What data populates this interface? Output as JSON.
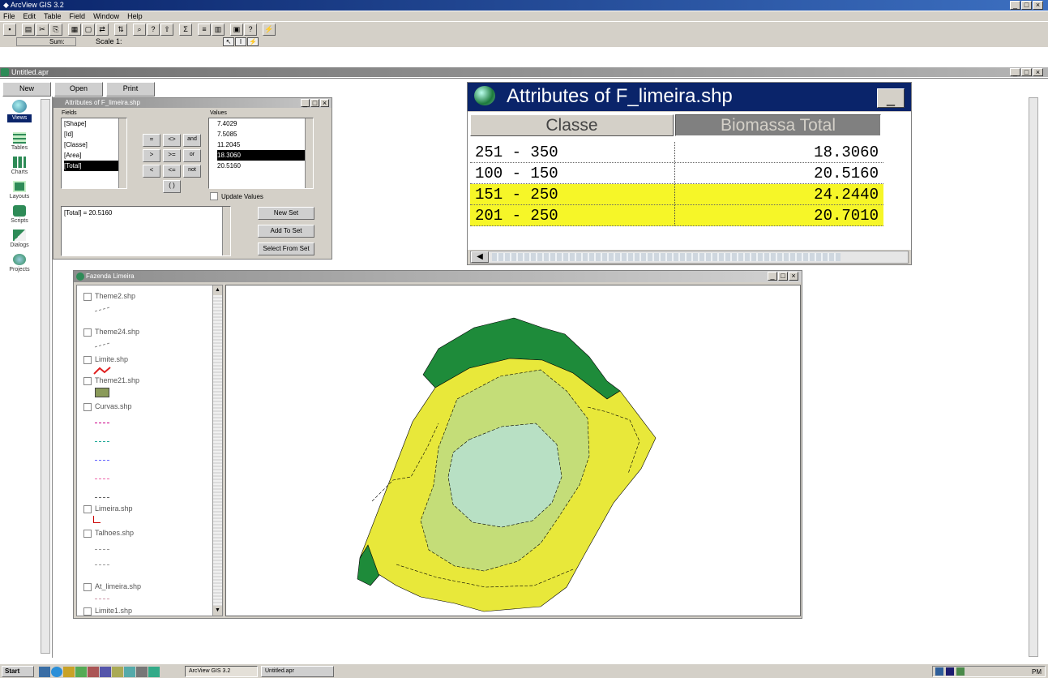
{
  "app": {
    "title": "ArcView GIS 3.2",
    "menu": [
      "File",
      "Edit",
      "Table",
      "Field",
      "Window",
      "Help"
    ],
    "scale_label": "Scale 1:",
    "sum_label": "Sum:"
  },
  "project": {
    "title": "Untitled.apr",
    "buttons": [
      "New",
      "Open",
      "Print"
    ],
    "side_items": [
      "Views",
      "Tables",
      "Charts",
      "Layouts",
      "Scripts",
      "Dialogs",
      "Projects"
    ]
  },
  "query": {
    "title": "Attributes of F_limeira.shp",
    "fields_label": "Fields",
    "values_label": "Values",
    "fields": [
      "[Shape]",
      "[Id]",
      "[Classe]",
      "[Area]",
      "[Total]"
    ],
    "values": [
      "7.4029",
      "7.5085",
      "11.2045",
      "18.3060",
      "20.5160"
    ],
    "operators": [
      "=",
      "<>",
      "and",
      ">",
      ">=",
      "or",
      "<",
      "<=",
      "not",
      "( )"
    ],
    "expression": "[Total] = 20.5160",
    "update_label": "Update Values",
    "buttons": [
      "New Set",
      "Add To Set",
      "Select From Set"
    ]
  },
  "attributes": {
    "title": "Attributes of F_limeira.shp",
    "columns": [
      "Classe",
      "Biomassa Total"
    ],
    "rows": [
      {
        "classe": "251 - 350",
        "biomassa": "18.3060",
        "selected": false
      },
      {
        "classe": "100 - 150",
        "biomassa": "20.5160",
        "selected": false
      },
      {
        "classe": "151 - 250",
        "biomassa": "24.2440",
        "selected": true
      },
      {
        "classe": "201 - 250",
        "biomassa": "20.7010",
        "selected": true
      }
    ]
  },
  "view": {
    "title": "Fazenda Limeira",
    "legend": [
      "Theme2.shp",
      "Theme24.shp",
      "Limite.shp",
      "Theme21.shp",
      "Curvas.shp",
      "Limeira.shp",
      "Talhoes.shp",
      "At_limeira.shp",
      "Limite1.shp"
    ],
    "map_colors": [
      "#1e8b3a",
      "#e8e83a",
      "#c4dd78",
      "#b8e0c4"
    ]
  },
  "taskbar": {
    "start": "Start",
    "items": [
      "ArcView GIS 3.2",
      "Untitled.apr"
    ],
    "clock": "PM"
  }
}
